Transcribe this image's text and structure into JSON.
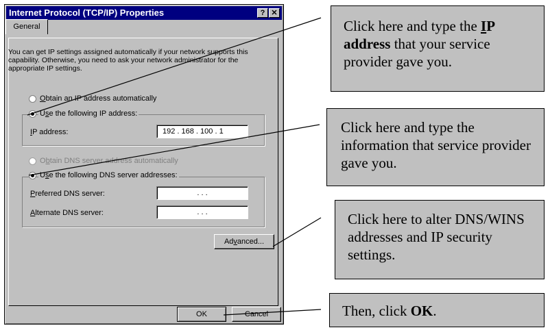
{
  "dialog": {
    "title": "Internet Protocol (TCP/IP) Properties",
    "help_label": "?",
    "close_label": "✕",
    "tab_general": "General",
    "description": "You can get IP settings assigned automatically if your network supports this capability. Otherwise, you need to ask your network administrator for the appropriate IP settings.",
    "ip_auto_label": {
      "key": "O",
      "rest": "btain an IP address automatically"
    },
    "ip_manual_label": {
      "pre": "U",
      "key": "s",
      "rest": "e the following IP address:"
    },
    "ip_address_label": {
      "key": "I",
      "rest": "P address:"
    },
    "ip_address_value": "192 . 168 . 100 .  1",
    "dns_auto_label": {
      "pre": "O",
      "key": "b",
      "rest": "tain DNS server address automatically"
    },
    "dns_manual_label": {
      "pre": "U",
      "key": "s",
      "rest": "e the following DNS server addresses:"
    },
    "preferred_dns_label": {
      "key": "P",
      "rest": "referred DNS server:"
    },
    "preferred_dns_value": ".        .        .",
    "alternate_dns_label": {
      "key": "A",
      "rest": "lternate DNS server:"
    },
    "alternate_dns_value": ".        .        .",
    "advanced_label": {
      "pre": "Ad",
      "key": "v",
      "rest": "anced..."
    },
    "ok_label": "OK",
    "cancel_label": "Cancel"
  },
  "callouts": {
    "ip": {
      "pre": "Click here and type the ",
      "bold_u": "I",
      "bold_rest": "P address",
      "post": " that your service provider gave you."
    },
    "dns": "Click here and type the information that service provider gave you.",
    "advanced": "Click here to alter DNS/WINS addresses and IP security settings.",
    "ok": {
      "pre": "Then, click ",
      "bold": "OK",
      "post": "."
    }
  }
}
